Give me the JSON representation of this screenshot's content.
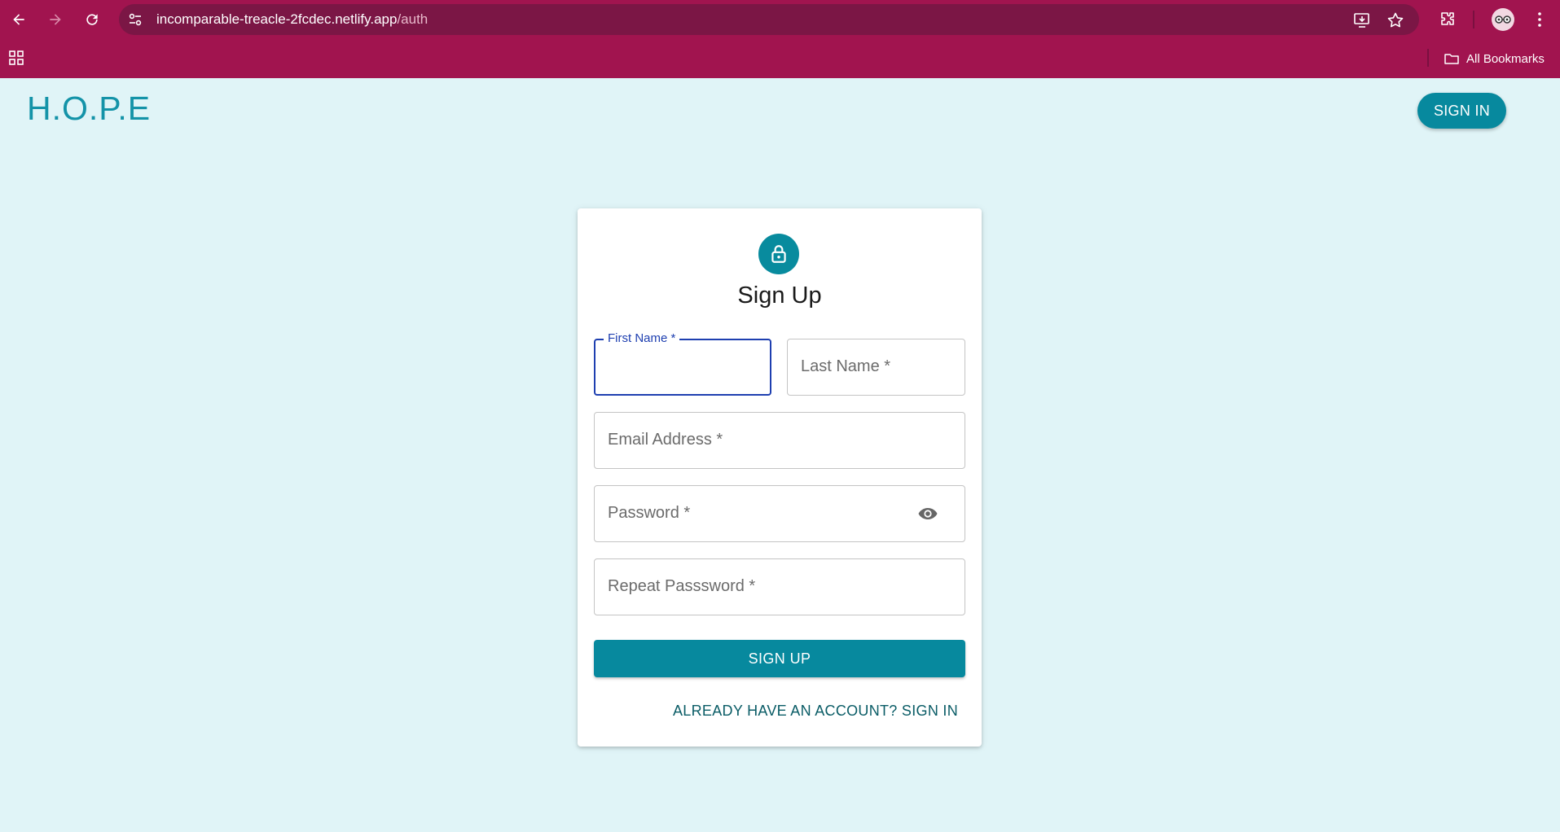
{
  "browser": {
    "url_host": "incomparable-treacle-2fcdec.netlify.app",
    "url_path": "/auth",
    "all_bookmarks_label": "All Bookmarks",
    "icons": [
      "back-icon",
      "forward-icon",
      "reload-icon",
      "site-settings-icon",
      "install-app-icon",
      "bookmark-star-icon",
      "extensions-icon",
      "profile-avatar",
      "menu-icon",
      "apps-grid-icon",
      "folder-icon"
    ]
  },
  "header": {
    "logo": "H.O.P.E",
    "sign_in_label": "SIGN IN"
  },
  "form": {
    "title": "Sign Up",
    "icon": "lock-icon",
    "first_name_label": "First Name *",
    "first_name_value": "",
    "last_name_label": "Last Name *",
    "email_label": "Email Address *",
    "password_label": "Password *",
    "repeat_password_label": "Repeat Passsword *",
    "submit_label": "SIGN UP",
    "signin_link": "ALREADY HAVE AN ACCOUNT? SIGN IN"
  },
  "colors": {
    "chrome": "#a1144f",
    "omnibox": "#7b1645",
    "page_bg": "#e0f4f7",
    "accent": "#07899e",
    "focus": "#1e3fb0"
  }
}
